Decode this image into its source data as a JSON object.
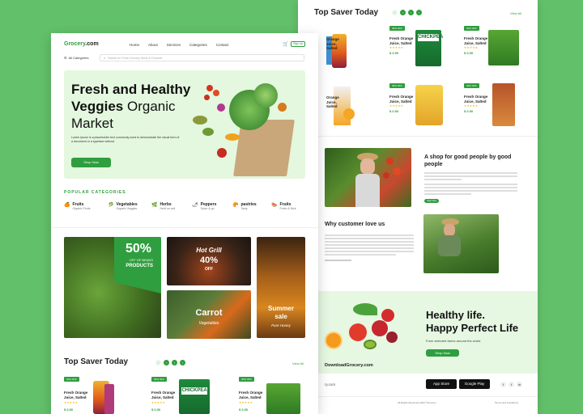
{
  "back": {
    "saver_title": "Top Saver Today",
    "view_all": "View All",
    "carousel": [
      "‹",
      "‹",
      "›",
      "›"
    ],
    "products_row1": [
      {
        "badge": "",
        "title": "Orange Juice, Salted",
        "price": ""
      },
      {
        "badge": "30% OFF",
        "title": "Fresh Orange Juice, Salted",
        "price": "$ 0.50"
      },
      {
        "badge": "30% OFF",
        "title": "Fresh Orange Juice, Salted",
        "price": "$ 0.50"
      }
    ],
    "products_row2": [
      {
        "badge": "",
        "title": "Orange Juice, Salted",
        "price": ""
      },
      {
        "badge": "30% OFF",
        "title": "Fresh Orange Juice, Salted",
        "price": "$ 0.50"
      },
      {
        "badge": "30% OFF",
        "title": "Fresh Orange Juice, Salted",
        "price": "$ 0.50"
      }
    ],
    "about_title": "A shop for good people by good people",
    "about_btn": "Shop Now",
    "love_title": "Why customer love us",
    "healthy_title_1": "Healthy life.",
    "healthy_title_2": "Happy Perfect Life",
    "healthy_sub": "Form selected farms around the world",
    "healthy_btn": "Shop Now",
    "download": "DownloadGrocery.com",
    "app_store": "App Store",
    "google_play": "Google Play",
    "footer_left": "ry.com",
    "social": [
      "f",
      "t",
      "in"
    ],
    "copyright": "All Rights Reserved 2024 ©Grocery",
    "footer_right": "Terms and Conditions"
  },
  "front": {
    "logo_main": "Grocery",
    "logo_suffix": ".com",
    "nav": [
      "Home",
      "About",
      "Services",
      "Categories",
      "Contact"
    ],
    "signup": "Sign up",
    "all_categories": "All Categories",
    "search_placeholder": "Search for Fresh Grocery Items & Products",
    "hero_line1": "Fresh and Healthy",
    "hero_line2a": "Veggies",
    "hero_line2b": "Organic",
    "hero_line3": "Market",
    "hero_desc": "Lorem Ipsum is a placeholder text commonly used to demonstrate the visual form of a document or a typeface without.",
    "hero_btn": "Shop Now",
    "popular_title": "POPULAR CATEGORIES",
    "categories": [
      {
        "name": "Fruits",
        "sub": "Organic Fruits"
      },
      {
        "name": "Vegetables",
        "sub": "Organic Veggies"
      },
      {
        "name": "Herbs",
        "sub": "Herb on sell"
      },
      {
        "name": "Peppers",
        "sub": "Spice & go"
      },
      {
        "name": "pastries",
        "sub": "Tasty"
      },
      {
        "name": "Fruits",
        "sub": "Fresh & Nice"
      }
    ],
    "promo1_pct": "50%",
    "promo1_l1": "OFF OF BEANS",
    "promo1_l2": "PRODUCTS",
    "promo2_title": "Hot Grill",
    "promo2_pct": "40%",
    "promo2_off": "OFF",
    "promo3_title": "Carrot",
    "promo3_sub": "Vegetables",
    "promo4_l1": "Summer",
    "promo4_l2": "sale",
    "promo4_sub": "Pure Honey",
    "saver_title": "Top Saver Today",
    "view_all": "View All",
    "carousel": [
      "‹",
      "‹",
      "›",
      "›"
    ],
    "products": [
      {
        "badge": "30% OFF",
        "title": "Fresh Orange Juice, Salted",
        "price": "$ 0.50"
      },
      {
        "badge": "30% OFF",
        "title": "Fresh Orange Juice, Salted",
        "price": "$ 0.50"
      },
      {
        "badge": "30% OFF",
        "title": "Fresh Orange Juice, Salted",
        "price": "$ 0.50"
      }
    ]
  },
  "colors": {
    "accent": "#2f9e3e",
    "background": "#63c06a",
    "hero_bg": "#e4f7df"
  }
}
